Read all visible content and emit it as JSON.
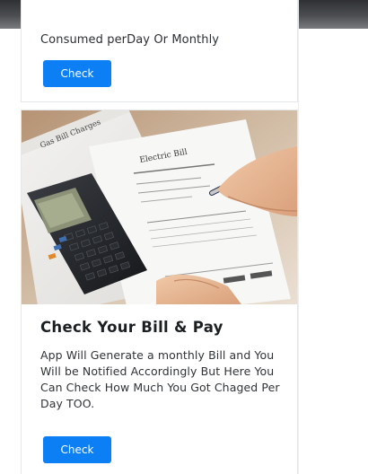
{
  "top_card": {
    "description_tail": "Consumed perDay Or Monthly",
    "button_label": "Check"
  },
  "bill_card": {
    "image": {
      "subject": "bill-calculator-pen-photo",
      "paper_heading_left": "Gas Bill Charges",
      "paper_heading_right": "Electric Bill"
    },
    "title": "Check Your Bill & Pay",
    "description": "App Will Generate a monthly Bill and You Will be Notified Accordingly But Here You Can Check How Much You Got Chaged Per Day TOO.",
    "button_label": "Check"
  },
  "colors": {
    "primary_button": "#0d7ff5",
    "card_border": "#e3e6ea"
  }
}
